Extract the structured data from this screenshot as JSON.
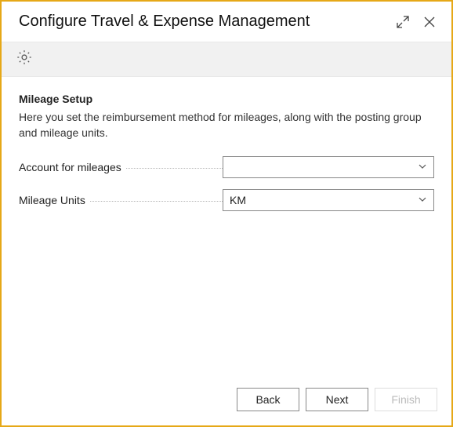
{
  "titlebar": {
    "title": "Configure Travel & Expense Management"
  },
  "section": {
    "title": "Mileage Setup",
    "description": "Here you set the reimbursement method for mileages, along with the posting group and mileage units."
  },
  "form": {
    "account_label": "Account for mileages",
    "account_value": "",
    "units_label": "Mileage Units",
    "units_value": "KM"
  },
  "footer": {
    "back": "Back",
    "next": "Next",
    "finish": "Finish"
  }
}
